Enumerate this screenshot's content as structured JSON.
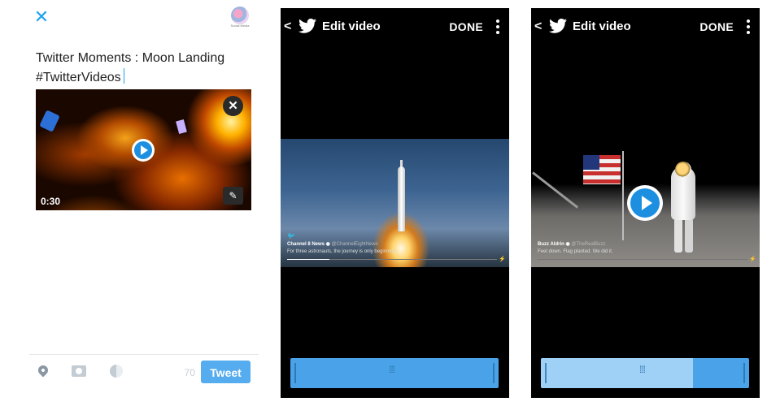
{
  "compose": {
    "close_icon": "close-icon",
    "tweet_lines": [
      "Twitter Moments : Moon Landing",
      "#TwitterVideos"
    ],
    "video_duration": "0:30",
    "char_count": "70",
    "tweet_button": "Tweet",
    "accent_color": "#1da1f2"
  },
  "editors": [
    {
      "title": "Edit video",
      "done_label": "DONE",
      "card": {
        "name": "Channel 8 News",
        "handle": "@ChannelEightNews",
        "text": "For three astronauts, the journey is only beginning."
      },
      "progress_fraction": 0.2,
      "trim_selected_fraction": 0.0
    },
    {
      "title": "Edit video",
      "done_label": "DONE",
      "card": {
        "name": "Buzz Aldrin",
        "handle": "@TheRealBuzz",
        "text": "Feet down. Flag planted. We did it."
      },
      "progress_fraction": 0.0,
      "trim_selected_fraction": 0.73
    }
  ]
}
